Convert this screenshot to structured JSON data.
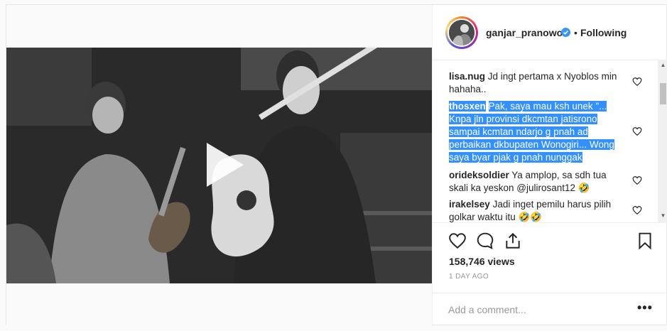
{
  "post": {
    "username": "ganjar_pranowo",
    "separator": "•",
    "follow_status": "Following"
  },
  "comments": [
    {
      "user": "lisa.nug",
      "lines": [
        "Jd ingt pertama x Nyoblos min",
        "hahaha.."
      ]
    },
    {
      "user": "thosxen",
      "lines": [
        "Pak, saya mau ksh unek \"...",
        "Knpa jln provinsi dkcmtan jatisrono",
        "sampai kcmtan ndarjo g pnah ad",
        "perbaikan dkbupaten Wonogiri... Wong",
        "saya byar pjak g pnah nunggak"
      ]
    },
    {
      "user": "orideksoldier",
      "lines": [
        "Ya amplop, sa sdh tua",
        "skali ka yeskon @julirosant12 🤣"
      ]
    },
    {
      "user": "irakelsey",
      "lines": [
        "Jadi inget pemilu harus pilih",
        "golkar waktu itu 🤣🤣"
      ]
    }
  ],
  "stats": {
    "views": "158,746 views",
    "time": "1 DAY AGO"
  },
  "composer": {
    "placeholder": "Add a comment...",
    "more_label": "•••"
  },
  "icons": {
    "play": "play-icon",
    "verified": "verified-badge-icon",
    "like": "heart-icon",
    "comment": "comment-bubble-icon",
    "share": "share-icon",
    "save": "bookmark-icon"
  },
  "colors": {
    "verified": "#3897f0",
    "selection": "#3390ff",
    "muted": "#999999"
  }
}
